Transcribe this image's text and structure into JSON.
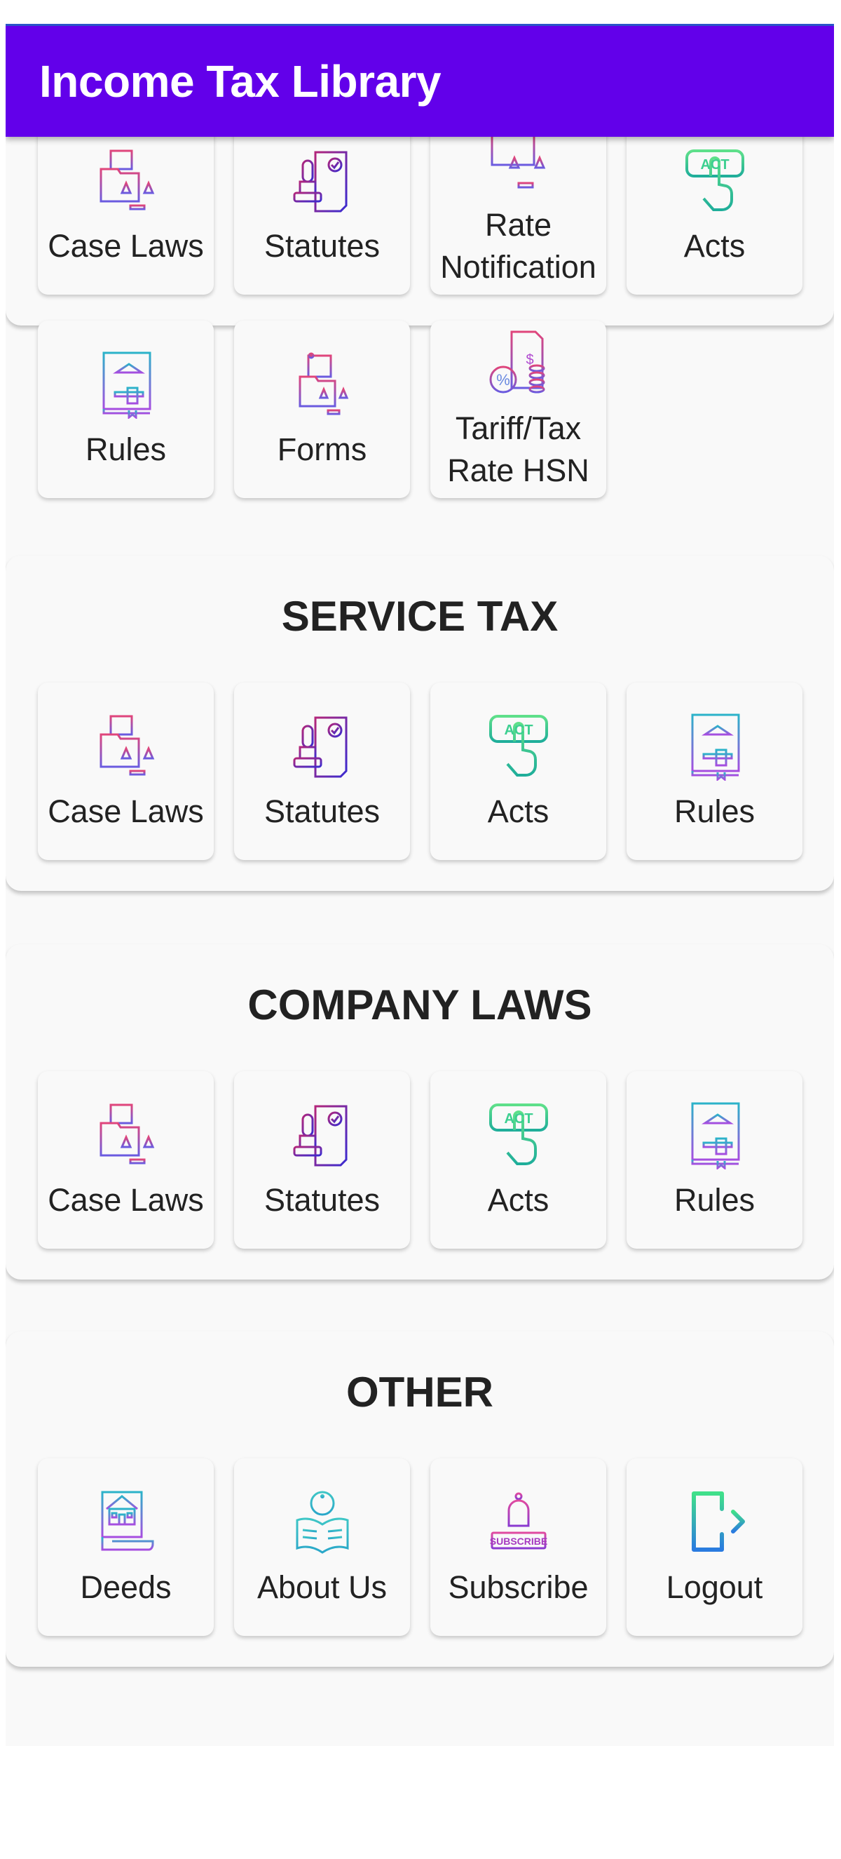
{
  "app_bar": {
    "title": "Income Tax Library",
    "color": "#6200ea"
  },
  "sections": [
    {
      "title": "",
      "items": [
        {
          "label": "Case Laws",
          "icon": "case-laws-icon"
        },
        {
          "label": "Statutes",
          "icon": "statutes-icon"
        },
        {
          "label": "Rate Notification",
          "icon": "rate-notification-icon"
        },
        {
          "label": "Acts",
          "icon": "acts-icon"
        },
        {
          "label": "Rules",
          "icon": "rules-icon"
        },
        {
          "label": "Forms",
          "icon": "forms-icon"
        },
        {
          "label": "Tariff/Tax Rate HSN",
          "icon": "tariff-icon"
        }
      ]
    },
    {
      "title": "SERVICE TAX",
      "items": [
        {
          "label": "Case Laws",
          "icon": "case-laws-icon"
        },
        {
          "label": "Statutes",
          "icon": "statutes-icon"
        },
        {
          "label": "Acts",
          "icon": "acts-icon"
        },
        {
          "label": "Rules",
          "icon": "rules-icon"
        }
      ]
    },
    {
      "title": "COMPANY LAWS",
      "items": [
        {
          "label": "Case Laws",
          "icon": "case-laws-icon"
        },
        {
          "label": "Statutes",
          "icon": "statutes-icon"
        },
        {
          "label": "Acts",
          "icon": "acts-icon"
        },
        {
          "label": "Rules",
          "icon": "rules-icon"
        }
      ]
    },
    {
      "title": "OTHER",
      "items": [
        {
          "label": "Deeds",
          "icon": "deeds-icon"
        },
        {
          "label": "About Us",
          "icon": "about-icon"
        },
        {
          "label": "Subscribe",
          "icon": "subscribe-icon",
          "icon_text": "SUBSCRIBE"
        },
        {
          "label": "Logout",
          "icon": "logout-icon"
        }
      ]
    }
  ]
}
